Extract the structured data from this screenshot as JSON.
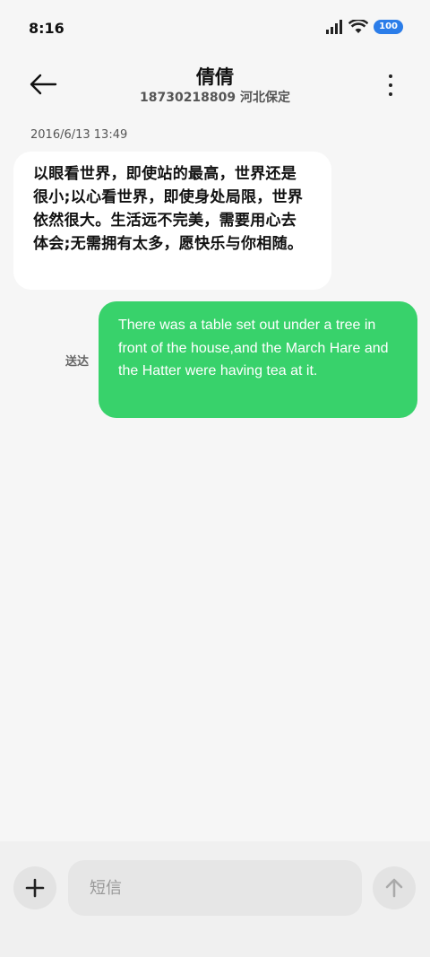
{
  "status_bar": {
    "time": "8:16",
    "battery": "100",
    "icons": [
      "signal-icon",
      "wifi-icon",
      "battery-icon"
    ]
  },
  "header": {
    "back_icon": "arrow-left-icon",
    "contact_name": "倩倩",
    "contact_sub": "18730218809 河北保定",
    "more_icon": "more-vertical-icon"
  },
  "conversation": {
    "timestamp": "2016/6/13 13:49",
    "incoming_message": "以眼看世界，即使站的最高，世界还是很小;以心看世界，即使身处局限，世界依然很大。生活远不完美，需要用心去体会;无需拥有太多，愿快乐与你相随。",
    "outgoing_message": "There was a table set out under a tree in front of the house,and the March Hare and the Hatter were having tea at it.",
    "delivered_label": "送达"
  },
  "input_bar": {
    "add_icon": "plus-icon",
    "placeholder": "短信",
    "send_icon": "arrow-up-icon"
  },
  "colors": {
    "background": "#f6f6f6",
    "incoming_bubble": "#ffffff",
    "outgoing_bubble": "#38d26b",
    "battery_badge": "#2b7de9"
  }
}
